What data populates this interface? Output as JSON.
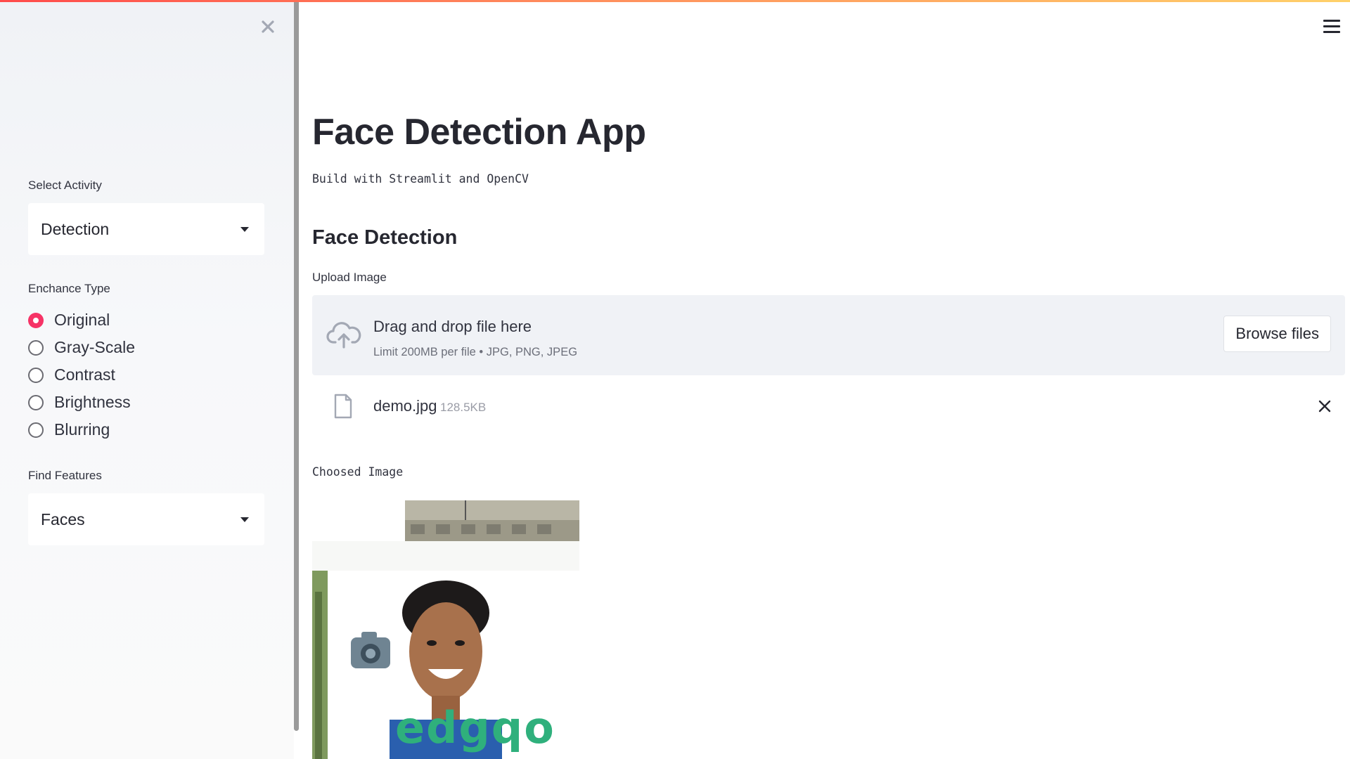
{
  "sidebar": {
    "select_activity": {
      "label": "Select Activity",
      "value": "Detection"
    },
    "enhance_type": {
      "label": "Enchance Type",
      "options": [
        "Original",
        "Gray-Scale",
        "Contrast",
        "Brightness",
        "Blurring"
      ],
      "selected": "Original"
    },
    "find_features": {
      "label": "Find Features",
      "value": "Faces"
    }
  },
  "main": {
    "title": "Face Detection App",
    "subtitle": "Build with Streamlit and OpenCV",
    "section_title": "Face Detection",
    "uploader": {
      "label": "Upload Image",
      "drop_text": "Drag and drop file here",
      "limit_text": "Limit 200MB per file • JPG, PNG, JPEG",
      "browse_label": "Browse files"
    },
    "uploaded_file": {
      "name": "demo.jpg",
      "size": "128.5KB"
    },
    "image_caption": "Choosed Image",
    "image_description": "Photo of a smiling young man in front of a building, with a camera logo and green lettering"
  },
  "colors": {
    "accent": "#f63366",
    "sidebar_bg": "#f0f2f6",
    "dropzone_bg": "#f0f2f6",
    "text": "#262730"
  },
  "icons": [
    "close-icon",
    "hamburger-menu-icon",
    "cloud-upload-icon",
    "file-icon",
    "remove-file-icon",
    "caret-down-icon"
  ]
}
